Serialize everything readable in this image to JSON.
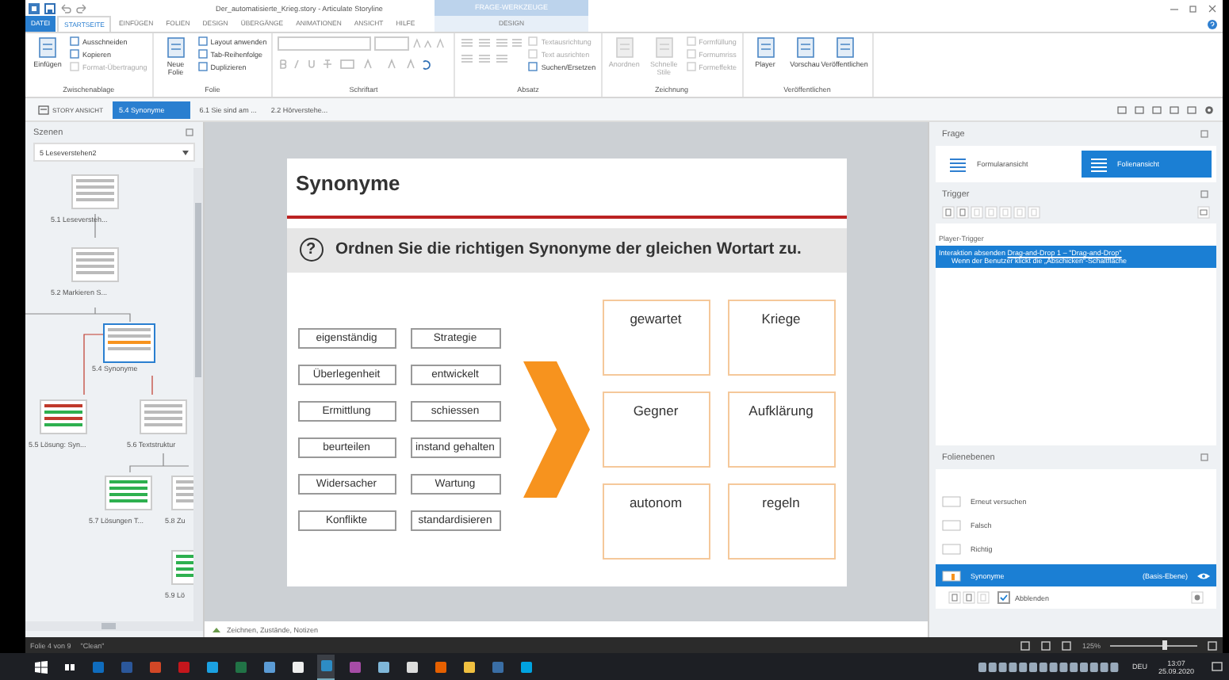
{
  "window": {
    "title": "Der_automatisierte_Krieg.story - Articulate Storyline",
    "context_group": "FRAGE-WERKZEUGE"
  },
  "ribbon_tabs": [
    {
      "label": "DATEI",
      "kind": "file",
      "selected": false
    },
    {
      "label": "STARTSEITE",
      "kind": "tab",
      "selected": true
    },
    {
      "label": "EINFÜGEN",
      "kind": "tab",
      "selected": false
    },
    {
      "label": "FOLIEN",
      "kind": "tab",
      "selected": false
    },
    {
      "label": "DESIGN",
      "kind": "tab",
      "selected": false
    },
    {
      "label": "ÜBERGÄNGE",
      "kind": "tab",
      "selected": false
    },
    {
      "label": "ANIMATIONEN",
      "kind": "tab",
      "selected": false
    },
    {
      "label": "ANSICHT",
      "kind": "tab",
      "selected": false
    },
    {
      "label": "HILFE",
      "kind": "tab",
      "selected": false
    },
    {
      "label": "DESIGN",
      "kind": "context",
      "selected": false
    }
  ],
  "ribbon_groups": [
    {
      "title": "Zwischenablage",
      "kind": "buttons",
      "items": [
        {
          "label": "Einfügen",
          "kind": "large",
          "disabled": false
        },
        {
          "label": "Ausschneiden",
          "kind": "small",
          "disabled": false
        },
        {
          "label": "Kopieren",
          "kind": "small",
          "disabled": false
        },
        {
          "label": "Format-Übertragung",
          "kind": "small",
          "disabled": true
        }
      ]
    },
    {
      "title": "Folie",
      "kind": "buttons",
      "items": [
        {
          "label": "Neue Folie",
          "kind": "large",
          "disabled": false
        },
        {
          "label": "Layout anwenden",
          "kind": "small",
          "disabled": false
        },
        {
          "label": "Tab-Reihenfolge",
          "kind": "small",
          "disabled": false
        },
        {
          "label": "Duplizieren",
          "kind": "small",
          "disabled": false
        }
      ]
    },
    {
      "title": "Schriftart",
      "kind": "font"
    },
    {
      "title": "Absatz",
      "kind": "paragraph",
      "items": [
        {
          "label": "Textausrichtung",
          "kind": "small",
          "disabled": true
        },
        {
          "label": "Text ausrichten",
          "kind": "small",
          "disabled": true
        },
        {
          "label": "Suchen/Ersetzen",
          "kind": "small",
          "disabled": false
        }
      ]
    },
    {
      "title": "Zeichnung",
      "kind": "buttons",
      "items": [
        {
          "label": "Anordnen",
          "kind": "large",
          "disabled": true
        },
        {
          "label": "Schnelle Stile",
          "kind": "large",
          "disabled": true
        },
        {
          "label": "Formfüllung",
          "kind": "small",
          "disabled": true
        },
        {
          "label": "Formumriss",
          "kind": "small",
          "disabled": true
        },
        {
          "label": "Formeffekte",
          "kind": "small",
          "disabled": true
        }
      ]
    },
    {
      "title": "Veröffentlichen",
      "kind": "buttons",
      "items": [
        {
          "label": "Player",
          "kind": "large",
          "disabled": false
        },
        {
          "label": "Vorschau",
          "kind": "large",
          "disabled": false
        },
        {
          "label": "Veröffentlichen",
          "kind": "large",
          "disabled": false
        }
      ]
    }
  ],
  "story_tabs": [
    {
      "label": "STORY ANSICHT",
      "kind": "story",
      "selected": false
    },
    {
      "label": "5.4 Synonyme",
      "kind": "slide",
      "selected": true
    },
    {
      "label": "6.1 Sie sind am ...",
      "kind": "slide",
      "selected": false
    },
    {
      "label": "2.2 Hörverstehe...",
      "kind": "slide",
      "selected": false
    }
  ],
  "scenes_panel": {
    "title": "Szenen",
    "scene": "5 Leseverstehen2",
    "slides": [
      {
        "label": "5.1 Leseversteh...",
        "kind": "text",
        "selected": false
      },
      {
        "label": "5.2 Markieren S...",
        "kind": "text",
        "selected": false
      },
      {
        "label": "5.4 Synonyme",
        "kind": "drag",
        "selected": true
      },
      {
        "label": "5.5 Lösung: Syn...",
        "kind": "solution",
        "selected": false
      },
      {
        "label": "5.6 Textstruktur",
        "kind": "text",
        "selected": false
      },
      {
        "label": "5.7 Lösungen T...",
        "kind": "green",
        "selected": false
      },
      {
        "label": "5.8 Zu",
        "kind": "text",
        "selected": false
      },
      {
        "label": "5.9 Lö",
        "kind": "green",
        "selected": false
      }
    ]
  },
  "slide": {
    "title": "Synonyme",
    "question_mark": "?",
    "question": "Ordnen Sie die richtigen Synonyme der gleichen Wortart zu.",
    "words": [
      "eigenständig",
      "Strategie",
      "Überlegenheit",
      "entwickelt",
      "Ermittlung",
      "schiessen",
      "beurteilen",
      "instand gehalten",
      "Widersacher",
      "Wartung",
      "Konflikte",
      "standardisieren"
    ],
    "targets": [
      "gewartet",
      "Kriege",
      "Gegner",
      "Aufklärung",
      "autonom",
      "regeln"
    ]
  },
  "canvas_footer": "Zeichnen, Zustände, Notizen",
  "question_panel": {
    "title": "Frage",
    "views": [
      {
        "label": "Formularansicht",
        "selected": false
      },
      {
        "label": "Folienansicht",
        "selected": true
      }
    ]
  },
  "trigger_panel": {
    "title": "Trigger",
    "group": "Player-Trigger",
    "triggers": [
      {
        "action": "Interaktion absenden",
        "target": "Drag-and-Drop 1 – \"Drag-and-Drop\"",
        "condition": "Wenn der Benutzer klickt die „Abschicken“-Schaltfläche",
        "selected": true
      }
    ]
  },
  "layers_panel": {
    "title": "Folienebenen",
    "layers": [
      {
        "name": "Erneut versuchen",
        "kind": "layer",
        "selected": false
      },
      {
        "name": "Falsch",
        "kind": "layer",
        "selected": false
      },
      {
        "name": "Richtig",
        "kind": "layer",
        "selected": false
      },
      {
        "name": "Synonyme",
        "kind": "base",
        "note": "(Basis-Ebene)",
        "selected": true
      }
    ],
    "dim": {
      "label": "Abblenden",
      "checked": true
    }
  },
  "status_bar": {
    "slide_info": "Folie 4 von 9",
    "theme": "\"Clean\"",
    "zoom": "125%",
    "zoom_slider": {
      "level": 0.62
    }
  },
  "taskbar": {
    "apps": [
      {
        "kind": "start",
        "color": "#ffffff",
        "active": false
      },
      {
        "kind": "taskview",
        "color": "#ffffff",
        "active": false
      },
      {
        "kind": "app",
        "color": "#0f6cbd",
        "active": false
      },
      {
        "kind": "app",
        "color": "#2b579a",
        "active": false
      },
      {
        "kind": "app",
        "color": "#d24726",
        "active": false
      },
      {
        "kind": "app",
        "color": "#c4161c",
        "active": false
      },
      {
        "kind": "app",
        "color": "#1ba1e2",
        "active": false
      },
      {
        "kind": "app",
        "color": "#217346",
        "active": false
      },
      {
        "kind": "app",
        "color": "#5b9bd5",
        "active": false
      },
      {
        "kind": "app",
        "color": "#eeeeee",
        "active": false
      },
      {
        "kind": "app",
        "color": "#2d8cc4",
        "active": true
      },
      {
        "kind": "app",
        "color": "#a64ca6",
        "active": false
      },
      {
        "kind": "app",
        "color": "#7fb7d9",
        "active": false
      },
      {
        "kind": "app",
        "color": "#dddddd",
        "active": false
      },
      {
        "kind": "app",
        "color": "#e66000",
        "active": false
      },
      {
        "kind": "app",
        "color": "#f0c040",
        "active": false
      },
      {
        "kind": "app",
        "color": "#3a6ea5",
        "active": false
      },
      {
        "kind": "app",
        "color": "#00a3e0",
        "active": false
      }
    ],
    "language": "DEU",
    "time": "13:07",
    "date": "25.09.2020"
  }
}
